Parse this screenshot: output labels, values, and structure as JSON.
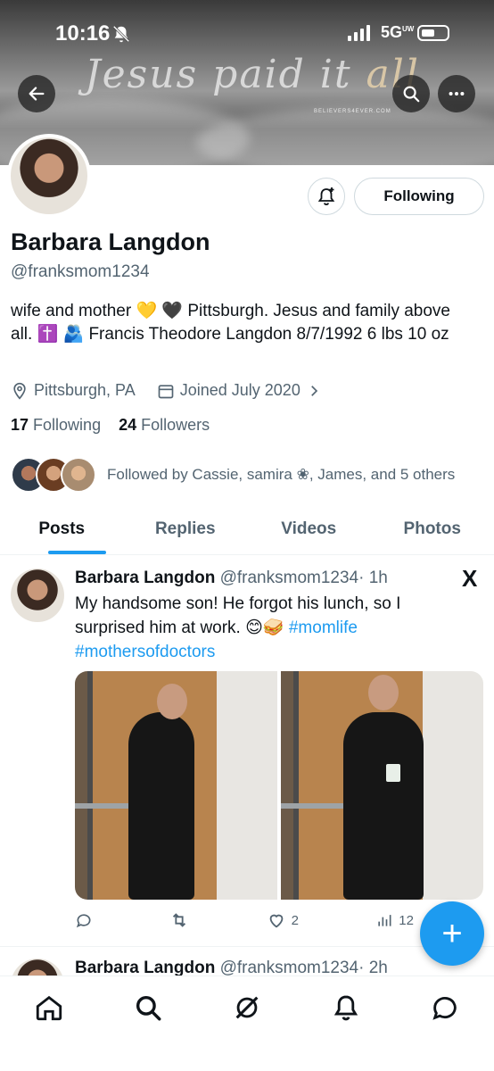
{
  "status_bar": {
    "time": "10:16",
    "network": "5G",
    "network_sup": "UW"
  },
  "banner": {
    "text_main": "Jesus paid it ",
    "text_accent": "all",
    "sub": "BELIEVERS4EVER.COM"
  },
  "profile": {
    "name": "Barbara Langdon",
    "handle": "@franksmom1234",
    "bio": "wife and mother 💛 🖤 Pittsburgh. Jesus and family above all. ✝️ 🫂 Francis Theodore Langdon 8/7/1992 6 lbs 10 oz",
    "location": "Pittsburgh, PA",
    "joined": "Joined July 2020",
    "following_count": "17",
    "following_label": "Following",
    "followers_count": "24",
    "followers_label": "Followers",
    "followed_by": "Followed by Cassie, samira ❀, James, and 5 others",
    "following_button": "Following"
  },
  "tabs": [
    {
      "label": "Posts",
      "active": true
    },
    {
      "label": "Replies",
      "active": false
    },
    {
      "label": "Videos",
      "active": false
    },
    {
      "label": "Photos",
      "active": false
    }
  ],
  "post": {
    "name": "Barbara Langdon",
    "handle": "@franksmom1234",
    "time": "· 1h",
    "text": "My handsome son! He forgot his lunch, so I surprised him at work. 😊🥪 ",
    "hashtag1": "#momlife",
    "hashtag2": "#mothersofdoctors",
    "likes": "2",
    "views": "12",
    "source_mark": "X"
  },
  "post2": {
    "name": "Barbara Langdon",
    "handle": "@franksmom1234",
    "time": "· 2h"
  },
  "fab_label": "+",
  "colors": {
    "accent": "#1d9bf0",
    "text": "#0f1419",
    "muted": "#536471"
  },
  "icons": {
    "back": "arrow-left-icon",
    "search": "search-icon",
    "more": "more-icon",
    "notify": "bell-plus-icon",
    "location": "location-pin-icon",
    "calendar": "calendar-icon",
    "reply": "reply-icon",
    "repost": "repost-icon",
    "like": "heart-icon",
    "views": "views-icon",
    "home": "home-icon",
    "explore": "search-icon",
    "grok": "grok-icon",
    "notifications": "bell-icon",
    "messages": "chat-icon"
  }
}
